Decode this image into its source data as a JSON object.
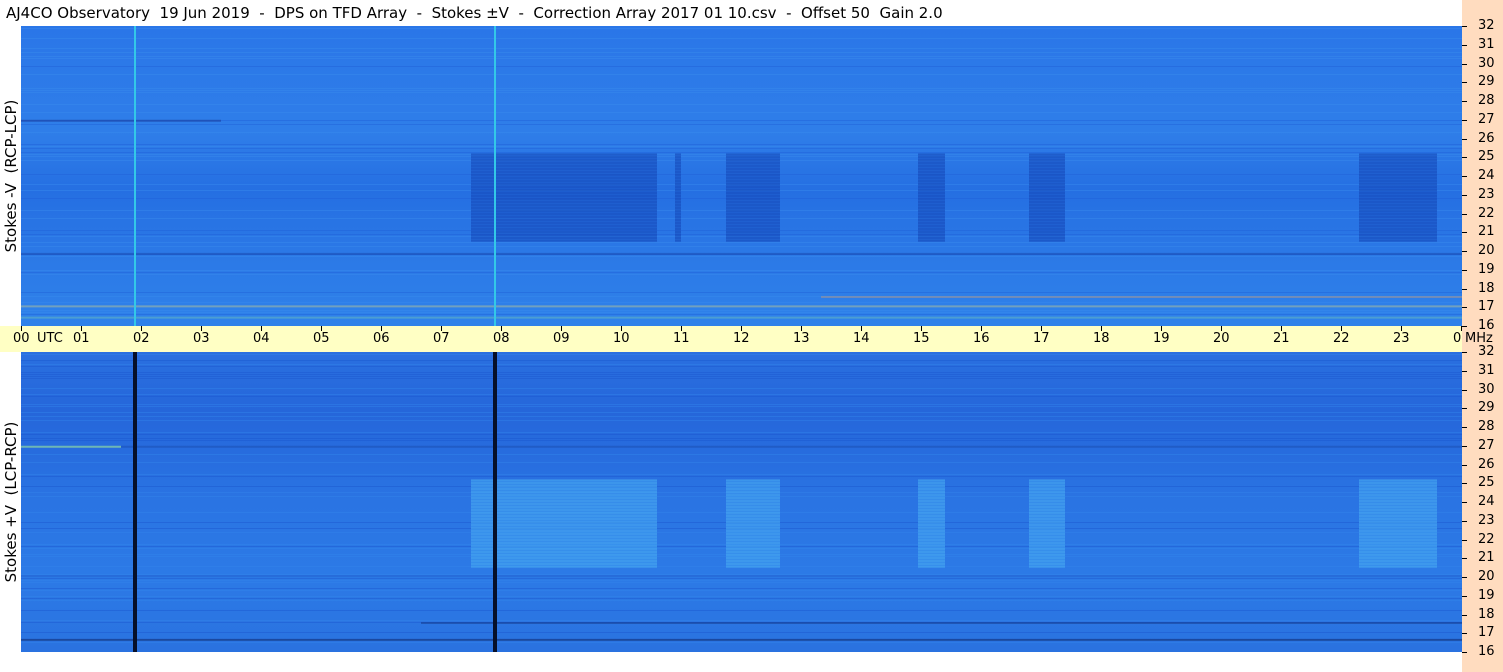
{
  "title": "AJ4CO Observatory  19 Jun 2019  -  DPS on TFD Array  -  Stokes ±V  -  Correction Array 2017 01 10.csv  -  Offset 50  Gain 2.0",
  "panels": {
    "top_label": "Stokes -V  (RCP-LCP)",
    "bottom_label": "Stokes +V  (LCP-RCP)"
  },
  "time_axis": {
    "labels": [
      "00",
      "UTC",
      "01",
      "02",
      "03",
      "04",
      "05",
      "06",
      "07",
      "08",
      "09",
      "10",
      "11",
      "12",
      "13",
      "14",
      "15",
      "16",
      "17",
      "18",
      "19",
      "20",
      "21",
      "22",
      "23",
      "00"
    ],
    "unit_label": "MHz"
  },
  "freq_axis": {
    "labels": [
      "32",
      "31",
      "30",
      "29",
      "28",
      "27",
      "26",
      "25",
      "24",
      "23",
      "22",
      "21",
      "20",
      "19",
      "18",
      "17",
      "16"
    ]
  },
  "colors": {
    "background_blue": "#2b78e6",
    "time_axis_bg": "#ffffc4",
    "freq_axis_bg": "#ffdcbf",
    "top_spike": "#33c8e8",
    "bottom_spike": "#06102a"
  },
  "chart_data": {
    "type": "heatmap",
    "title": "AJ4CO Observatory  19 Jun 2019  -  DPS on TFD Array  -  Stokes ±V  -  Correction Array 2017 01 10.csv  -  Offset 50  Gain 2.0",
    "xlabel": "UTC",
    "ylabel": "MHz",
    "x_range": [
      "00:00",
      "24:00"
    ],
    "y_range": [
      16,
      32
    ],
    "panels": [
      {
        "name": "Stokes -V  (RCP-LCP)",
        "vertical_lines_utc": [
          1.9,
          7.9
        ],
        "dark_block_bands_utc": [
          [
            7.5,
            10.6
          ],
          [
            10.9,
            11.0
          ],
          [
            11.75,
            12.65
          ],
          [
            14.95,
            15.4
          ],
          [
            16.8,
            17.4
          ],
          [
            22.3,
            23.6
          ]
        ],
        "block_freq_range_mhz": [
          20.5,
          25.2
        ]
      },
      {
        "name": "Stokes +V  (LCP-RCP)",
        "vertical_lines_utc": [
          1.9,
          7.9
        ],
        "bright_block_bands_utc": [
          [
            7.5,
            10.6
          ],
          [
            11.75,
            12.65
          ],
          [
            14.95,
            15.4
          ],
          [
            16.8,
            17.4
          ],
          [
            22.3,
            23.6
          ]
        ],
        "block_freq_range_mhz": [
          20.5,
          25.2
        ]
      }
    ]
  }
}
